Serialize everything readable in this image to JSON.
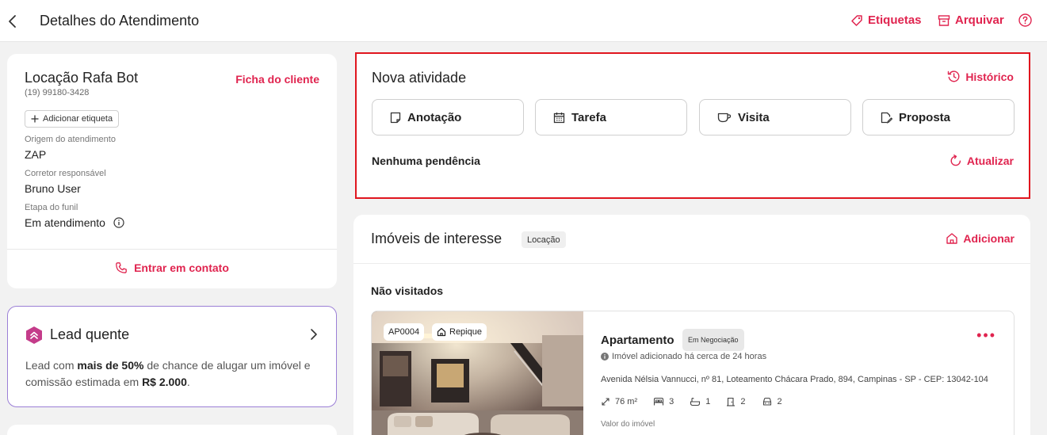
{
  "header": {
    "title": "Detalhes do Atendimento",
    "actions": {
      "etiquetas": "Etiquetas",
      "arquivar": "Arquivar"
    },
    "icons": [
      "back-chevron-icon",
      "tag-icon",
      "archive-icon",
      "help-icon"
    ]
  },
  "client": {
    "name": "Locação Rafa Bot",
    "phone": "(19) 99180-3428",
    "ficha_link": "Ficha do cliente",
    "add_tag": "Adicionar etiqueta",
    "origem_label": "Origem do atendimento",
    "origem_value": "ZAP",
    "corretor_label": "Corretor responsável",
    "corretor_value": "Bruno User",
    "etapa_label": "Etapa do funil",
    "etapa_value": "Em atendimento",
    "contact_button": "Entrar em contato"
  },
  "lead": {
    "title": "Lead quente",
    "text_prefix": "Lead com ",
    "text_bold1": "mais de 50%",
    "text_mid": " de chance de alugar um imóvel e comissão estimada em ",
    "text_bold2": "R$ 2.000",
    "text_suffix": "."
  },
  "activity": {
    "title": "Nova atividade",
    "historico": "Histórico",
    "buttons": {
      "anotacao": "Anotação",
      "tarefa": "Tarefa",
      "visita": "Visita",
      "proposta": "Proposta"
    },
    "pending": "Nenhuma pendência",
    "atualizar": "Atualizar"
  },
  "properties": {
    "title": "Imóveis de interesse",
    "badge": "Locação",
    "add": "Adicionar",
    "section": "Não visitados",
    "items": [
      {
        "code": "AP0004",
        "repique": "Repique",
        "type": "Apartamento",
        "status": "Em Negociação",
        "added_note": "Imóvel adicionado há cerca de 24 horas",
        "address": "Avenida Nélsia Vannucci, nº 81, Loteamento Chácara Prado, 894, Campinas - SP - CEP: 13042-104",
        "area": "76 m²",
        "bedrooms": "3",
        "bathrooms": "1",
        "suites": "2",
        "parking": "2",
        "valor_label": "Valor do imóvel"
      }
    ]
  },
  "colors": {
    "accent": "#e0244f",
    "highlight_border": "#e0161f",
    "lead_border": "#9b7fd6",
    "lead_icon": "#c43c8a"
  }
}
